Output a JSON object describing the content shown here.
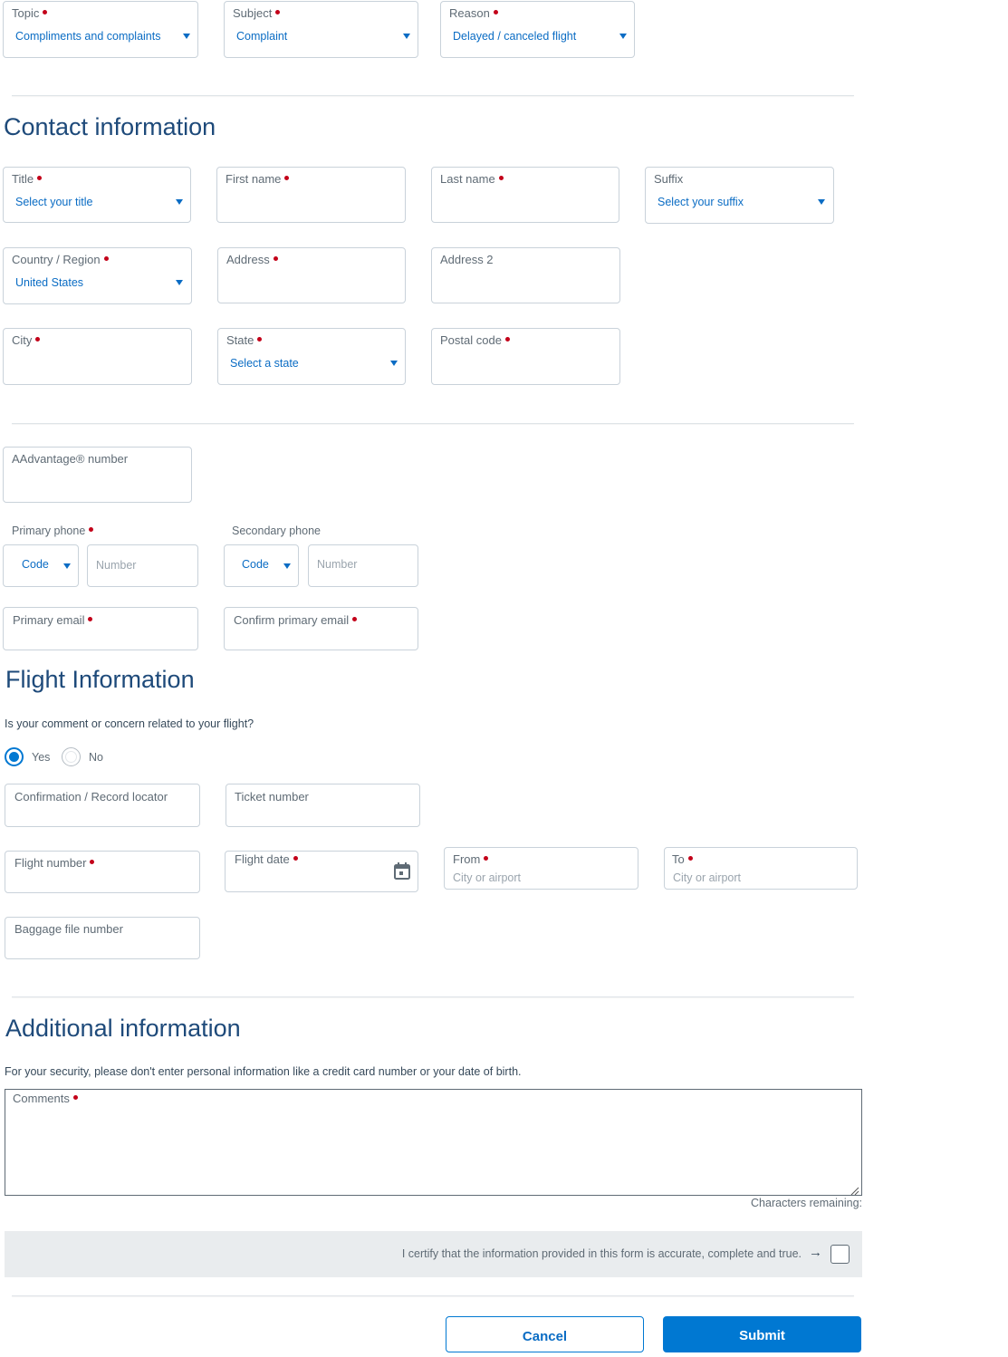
{
  "top": {
    "topic": {
      "label": "Topic",
      "value": "Compliments and complaints"
    },
    "subject": {
      "label": "Subject",
      "value": "Complaint"
    },
    "reason": {
      "label": "Reason",
      "value": "Delayed / canceled flight"
    }
  },
  "contact": {
    "heading": "Contact information",
    "title": {
      "label": "Title",
      "value": "Select your title"
    },
    "first_name": {
      "label": "First name"
    },
    "last_name": {
      "label": "Last name"
    },
    "suffix": {
      "label": "Suffix",
      "value": "Select your suffix"
    },
    "country": {
      "label": "Country / Region",
      "value": "United States"
    },
    "address": {
      "label": "Address"
    },
    "address2": {
      "label": "Address 2"
    },
    "city": {
      "label": "City"
    },
    "state": {
      "label": "State",
      "value": "Select a state"
    },
    "postal": {
      "label": "Postal code"
    },
    "aadvantage": {
      "label": "AAdvantage® number"
    },
    "primary_phone": {
      "label": "Primary phone",
      "code": "Code",
      "number_placeholder": "Number"
    },
    "secondary_phone": {
      "label": "Secondary phone",
      "code": "Code",
      "number_placeholder": "Number"
    },
    "primary_email": {
      "label": "Primary email"
    },
    "confirm_email": {
      "label": "Confirm primary email"
    }
  },
  "flight": {
    "heading": "Flight Information",
    "question": "Is your comment or concern related to your flight?",
    "yes_label": "Yes",
    "no_label": "No",
    "selected": "Yes",
    "confirmation": {
      "label": "Confirmation / Record locator"
    },
    "ticket": {
      "label": "Ticket number"
    },
    "flight_number": {
      "label": "Flight number"
    },
    "flight_date": {
      "label": "Flight date"
    },
    "from": {
      "label": "From",
      "placeholder": "City or airport"
    },
    "to": {
      "label": "To",
      "placeholder": "City or airport"
    },
    "baggage": {
      "label": "Baggage file number"
    }
  },
  "additional": {
    "heading": "Additional information",
    "security_note": "For your security, please don't enter personal information like a credit card number or your date of birth.",
    "comments_label": "Comments",
    "chars_remaining": "Characters remaining:",
    "certify_text": "I certify that the information provided in this form is accurate, complete and true.",
    "certify_arrow": "→",
    "certified": false
  },
  "actions": {
    "cancel": "Cancel",
    "submit": "Submit"
  },
  "colors": {
    "accent": "#0078d2",
    "required": "#c30019",
    "heading": "#1e4a7a"
  }
}
